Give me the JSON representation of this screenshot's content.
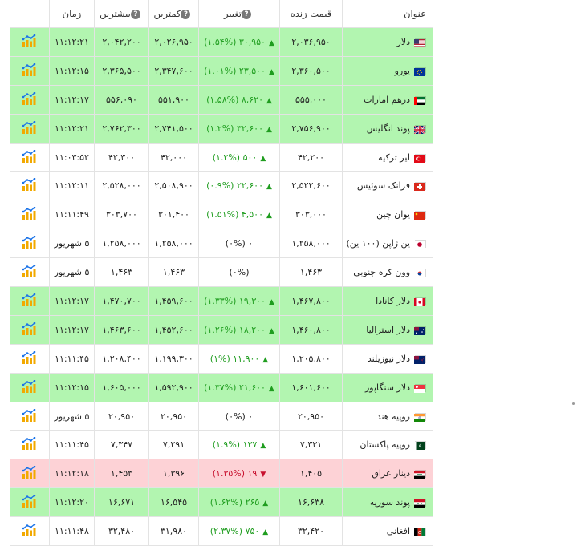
{
  "header": {
    "name": "عنوان",
    "live_price": "قیمت زنده",
    "change": "تغییر",
    "lowest": "کمترین",
    "highest": "بیشترین",
    "time": "زمان"
  },
  "rows": [
    {
      "name": "دلار",
      "flag": "us",
      "price": "۲,۰۳۶,۹۵۰",
      "change": "۳۰,۹۵۰ (۱.۵۴%)",
      "dir": "up",
      "low": "۲,۰۲۶,۹۵۰",
      "high": "۲,۰۴۲,۲۰۰",
      "time": "۱۱:۱۲:۲۱"
    },
    {
      "name": "یورو",
      "flag": "eu",
      "price": "۲,۳۶۰,۵۰۰",
      "change": "۲۳,۵۰۰ (۱.۰۱%)",
      "dir": "up",
      "low": "۲,۳۴۷,۶۰۰",
      "high": "۲,۳۶۵,۵۰۰",
      "time": "۱۱:۱۲:۱۵"
    },
    {
      "name": "درهم امارات",
      "flag": "ae",
      "price": "۵۵۵,۰۰۰",
      "change": "۸,۶۲۰ (۱.۵۸%)",
      "dir": "up",
      "low": "۵۵۱,۹۰۰",
      "high": "۵۵۶,۰۹۰",
      "time": "۱۱:۱۲:۱۷"
    },
    {
      "name": "پوند انگلیس",
      "flag": "gb",
      "price": "۲,۷۵۶,۹۰۰",
      "change": "۳۲,۶۰۰ (۱.۲%)",
      "dir": "up",
      "low": "۲,۷۴۱,۵۰۰",
      "high": "۲,۷۶۲,۳۰۰",
      "time": "۱۱:۱۲:۲۱"
    },
    {
      "name": "لیر ترکیه",
      "flag": "tr",
      "price": "۴۲,۲۰۰",
      "change": "۵۰۰ (۱.۲%)",
      "dir": "up-flat",
      "low": "۴۲,۰۰۰",
      "high": "۴۲,۳۰۰",
      "time": "۱۱:۰۳:۵۲"
    },
    {
      "name": "فرانک سوئیس",
      "flag": "ch",
      "price": "۲,۵۲۲,۶۰۰",
      "change": "۲۲,۶۰۰ (۰.۹%)",
      "dir": "up-flat",
      "low": "۲,۵۰۸,۹۰۰",
      "high": "۲,۵۲۸,۰۰۰",
      "time": "۱۱:۱۲:۱۱"
    },
    {
      "name": "یوان چین",
      "flag": "cn",
      "price": "۳۰۳,۰۰۰",
      "change": "۴,۵۰۰ (۱.۵۱%)",
      "dir": "up-flat",
      "low": "۳۰۱,۴۰۰",
      "high": "۳۰۳,۷۰۰",
      "time": "۱۱:۱۱:۴۹"
    },
    {
      "name": "ین ژاپن (۱۰۰ ین)",
      "flag": "jp",
      "price": "۱,۲۵۸,۰۰۰",
      "change": "۰ (۰%)",
      "dir": "none",
      "low": "۱,۲۵۸,۰۰۰",
      "high": "۱,۲۵۸,۰۰۰",
      "time": "۵ شهریور"
    },
    {
      "name": "وون کره جنوبی",
      "flag": "kr",
      "price": "۱,۴۶۳",
      "change": "(۰%)",
      "dir": "none",
      "low": "۱,۴۶۳",
      "high": "۱,۴۶۳",
      "time": "۵ شهریور"
    },
    {
      "name": "دلار کانادا",
      "flag": "ca",
      "price": "۱,۴۶۷,۸۰۰",
      "change": "۱۹,۳۰۰ (۱.۳۳%)",
      "dir": "up",
      "low": "۱,۴۵۹,۶۰۰",
      "high": "۱,۴۷۰,۷۰۰",
      "time": "۱۱:۱۲:۱۷"
    },
    {
      "name": "دلار استرالیا",
      "flag": "au",
      "price": "۱,۴۶۰,۸۰۰",
      "change": "۱۸,۲۰۰ (۱.۲۶%)",
      "dir": "up",
      "low": "۱,۴۵۲,۶۰۰",
      "high": "۱,۴۶۳,۶۰۰",
      "time": "۱۱:۱۲:۱۷"
    },
    {
      "name": "دلار نیوزیلند",
      "flag": "nz",
      "price": "۱,۲۰۵,۸۰۰",
      "change": "۱۱,۹۰۰ (۱%)",
      "dir": "up-flat",
      "low": "۱,۱۹۹,۳۰۰",
      "high": "۱,۲۰۸,۴۰۰",
      "time": "۱۱:۱۱:۴۵"
    },
    {
      "name": "دلار سنگاپور",
      "flag": "sg",
      "price": "۱,۶۰۱,۶۰۰",
      "change": "۲۱,۶۰۰ (۱.۳۷%)",
      "dir": "up",
      "low": "۱,۵۹۲,۹۰۰",
      "high": "۱,۶۰۵,۰۰۰",
      "time": "۱۱:۱۲:۱۵"
    },
    {
      "name": "روپیه هند",
      "flag": "in",
      "price": "۲۰,۹۵۰",
      "change": "۰ (۰%)",
      "dir": "none",
      "low": "۲۰,۹۵۰",
      "high": "۲۰,۹۵۰",
      "time": "۵ شهریور"
    },
    {
      "name": "روپیه پاکستان",
      "flag": "pk",
      "price": "۷,۳۳۱",
      "change": "۱۳۷ (۱.۹%)",
      "dir": "up-flat",
      "low": "۷,۲۹۱",
      "high": "۷,۳۴۷",
      "time": "۱۱:۱۱:۴۵"
    },
    {
      "name": "دینار عراق",
      "flag": "iq",
      "price": "۱,۴۰۵",
      "change": "۱۹ (۱.۳۵%)",
      "dir": "down",
      "low": "۱,۳۹۶",
      "high": "۱,۴۵۳",
      "time": "۱۱:۱۲:۱۸"
    },
    {
      "name": "پوند سوریه",
      "flag": "sy",
      "price": "۱۶,۶۳۸",
      "change": "۲۶۵ (۱.۶۲%)",
      "dir": "up",
      "low": "۱۶,۵۴۵",
      "high": "۱۶,۶۷۱",
      "time": "۱۱:۱۲:۲۰"
    },
    {
      "name": "افغانی",
      "flag": "af",
      "price": "۳۲,۴۲۰",
      "change": "۷۵۰ (۲.۳۷%)",
      "dir": "up-flat",
      "low": "۳۱,۹۸۰",
      "high": "۳۲,۴۸۰",
      "time": "۱۱:۱۱:۴۸"
    }
  ],
  "colors": {
    "up_row": "#b2f5b0",
    "down_row": "#fdd2d6",
    "up_text": "#1f9d1f",
    "down_text": "#c8102e"
  }
}
